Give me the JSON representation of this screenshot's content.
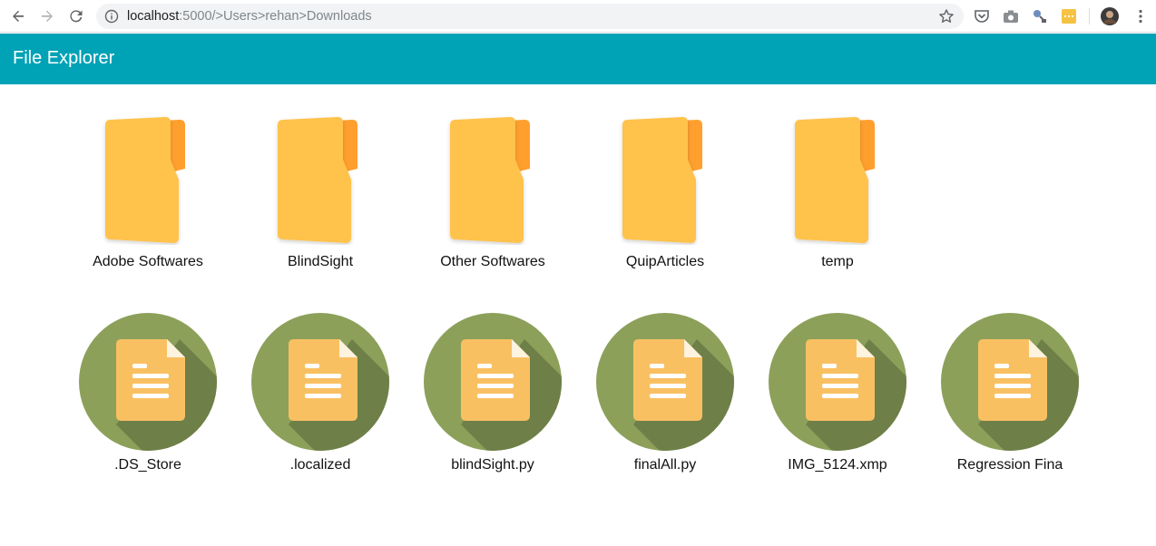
{
  "browser": {
    "url_host": "localhost",
    "url_rest": ":5000/>Users>rehan>Downloads"
  },
  "app": {
    "title": "File Explorer",
    "header_color": "#00a2b6"
  },
  "folders": [
    {
      "name": "Adobe Softwares",
      "icon": "folder-icon"
    },
    {
      "name": "BlindSight",
      "icon": "folder-icon"
    },
    {
      "name": "Other Softwares",
      "icon": "folder-icon"
    },
    {
      "name": "QuipArticles",
      "icon": "folder-icon"
    },
    {
      "name": "temp",
      "icon": "folder-icon"
    }
  ],
  "files": [
    {
      "name": ".DS_Store",
      "icon": "file-icon"
    },
    {
      "name": ".localized",
      "icon": "file-icon"
    },
    {
      "name": "blindSight.py",
      "icon": "file-icon"
    },
    {
      "name": "finalAll.py",
      "icon": "file-icon"
    },
    {
      "name": "IMG_5124.xmp",
      "icon": "file-icon"
    },
    {
      "name": "Regression Fina",
      "icon": "file-icon"
    }
  ]
}
